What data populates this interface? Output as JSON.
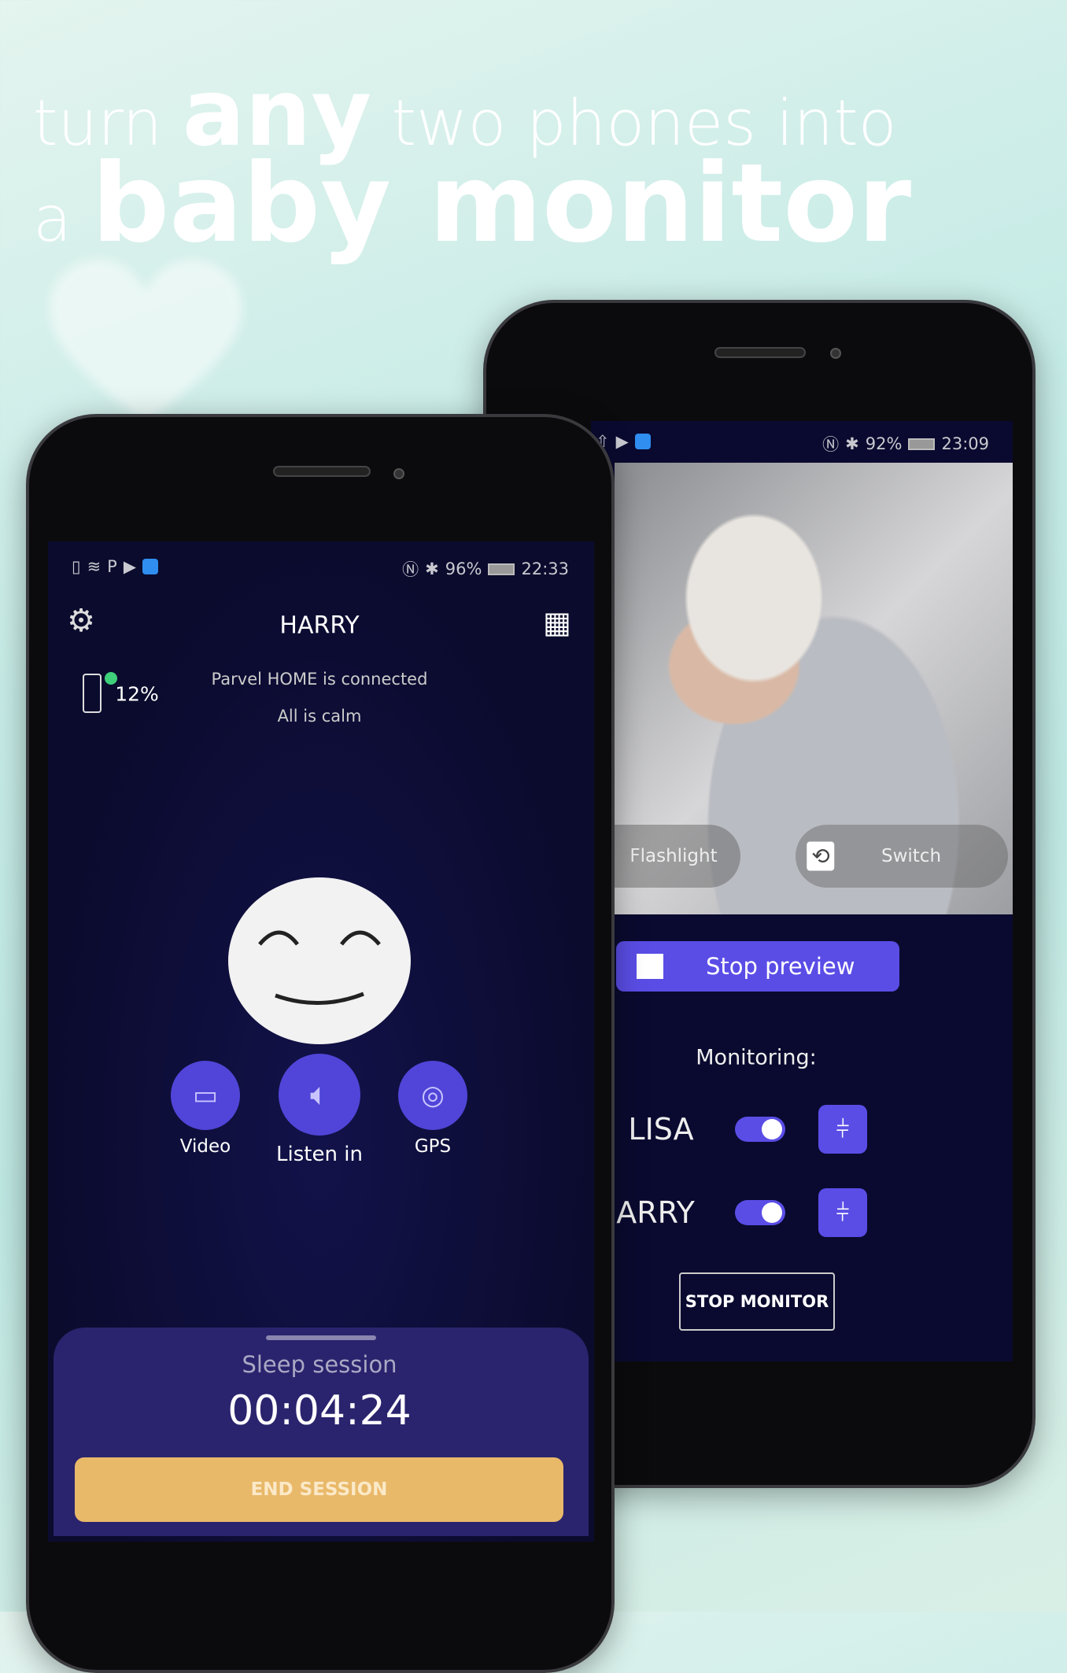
{
  "headline": {
    "line1_pre": "turn ",
    "line1_bold": "any",
    "line1_post": " two phones into",
    "line2_pre": "a ",
    "line2_bold": "baby monitor"
  },
  "front_phone": {
    "status": {
      "battery": "96%",
      "time": "22:33"
    },
    "title": "HARRY",
    "device_battery": "12%",
    "connection_text": "Parvel HOME is connected",
    "state_text": "All is calm",
    "actions": [
      {
        "label": "Video",
        "icon": "video-camera-icon"
      },
      {
        "label": "Listen in",
        "icon": "speaker-icon"
      },
      {
        "label": "GPS",
        "icon": "location-pin-icon"
      }
    ],
    "session": {
      "label": "Sleep session",
      "timer": "00:04:24",
      "end_label": "END SESSION"
    },
    "colors": {
      "accent": "#5045d8",
      "end_button": "#e9b96a",
      "background": "#0b0b2e"
    }
  },
  "back_phone": {
    "status": {
      "battery": "92%",
      "time": "23:09"
    },
    "preview": {
      "flashlight_label": "Flashlight",
      "switch_label": "Switch"
    },
    "stop_preview_label": "Stop preview",
    "monitoring_label": "Monitoring:",
    "monitors": [
      {
        "name": "LISA",
        "enabled": true
      },
      {
        "name": "ARRY",
        "enabled": true
      }
    ],
    "stop_monitor_label": "STOP MONITOR",
    "colors": {
      "accent": "#5a4de6"
    }
  }
}
